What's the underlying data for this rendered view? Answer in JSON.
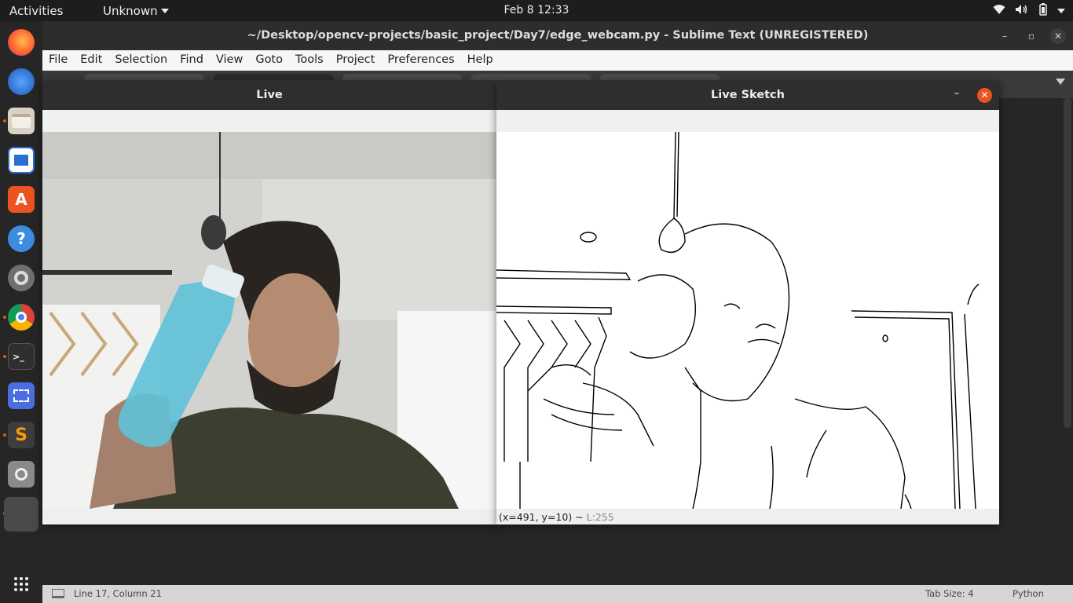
{
  "topbar": {
    "activities": "Activities",
    "app_menu": "Unknown",
    "clock": "Feb 8  12:33",
    "tray_icons": [
      "wifi-icon",
      "volume-icon",
      "battery-icon",
      "power-menu-icon"
    ]
  },
  "dock": {
    "items": [
      {
        "name": "firefox",
        "icon": "firefox-icon",
        "color": "#ff7139",
        "running": false
      },
      {
        "name": "thunderbird",
        "icon": "thunderbird-icon",
        "color": "#2a7dd8",
        "running": false
      },
      {
        "name": "files",
        "icon": "files-icon",
        "color": "#cfc7b8",
        "running": true
      },
      {
        "name": "libreoffice-writer",
        "icon": "writer-icon",
        "color": "#2a6fd0",
        "running": false
      },
      {
        "name": "ubuntu-software",
        "icon": "software-icon",
        "color": "#e95420",
        "running": false
      },
      {
        "name": "help",
        "icon": "help-icon",
        "color": "#3a8de0",
        "running": false
      },
      {
        "name": "settings",
        "icon": "settings-icon",
        "color": "#777777",
        "running": false
      },
      {
        "name": "chrome",
        "icon": "chrome-icon",
        "color": "#db4437",
        "running": true
      },
      {
        "name": "terminal",
        "icon": "terminal-icon",
        "color": "#333333",
        "running": true
      },
      {
        "name": "screenshot",
        "icon": "screenshot-icon",
        "color": "#4a6ee0",
        "running": false
      },
      {
        "name": "sublime-text",
        "icon": "sublime-icon",
        "color": "#3d3d3d",
        "running": true
      },
      {
        "name": "image-viewer",
        "icon": "magnifier-icon",
        "color": "#8a8a8a",
        "running": false
      },
      {
        "name": "python-window",
        "icon": "window-icon",
        "color": "#4a4a4a",
        "running": true
      }
    ],
    "show_apps_icon": "grid-icon"
  },
  "sublime": {
    "title": "~/Desktop/opencv-projects/basic_project/Day7/edge_webcam.py - Sublime Text (UNREGISTERED)",
    "menu": [
      "File",
      "Edit",
      "Selection",
      "Find",
      "View",
      "Goto",
      "Tools",
      "Project",
      "Preferences",
      "Help"
    ],
    "status": {
      "position": "Line 17, Column 21",
      "tab_size": "Tab Size: 4",
      "syntax": "Python"
    }
  },
  "live_window": {
    "title": "Live"
  },
  "sketch_window": {
    "title": "Live Sketch",
    "status_coords": "(x=491, y=10) ~",
    "status_value": "L:255"
  }
}
